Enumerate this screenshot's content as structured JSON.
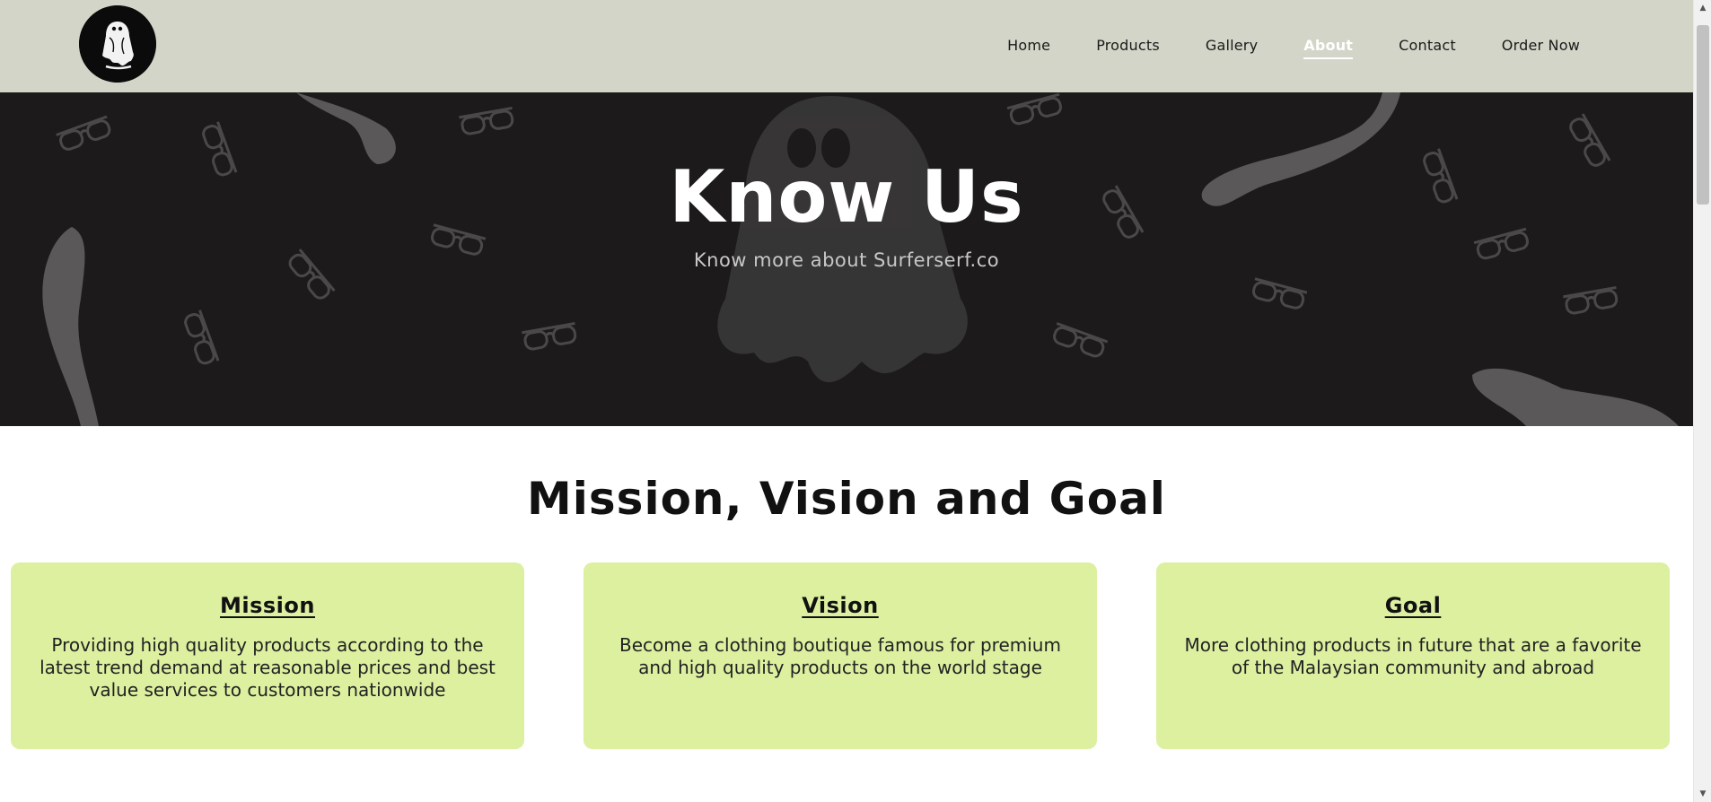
{
  "navbar": {
    "logo_icon": "ghost-logo-icon",
    "links": [
      {
        "label": "Home",
        "active": false
      },
      {
        "label": "Products",
        "active": false
      },
      {
        "label": "Gallery",
        "active": false
      },
      {
        "label": "About",
        "active": true
      },
      {
        "label": "Contact",
        "active": false
      },
      {
        "label": "Order Now",
        "active": false
      }
    ]
  },
  "hero": {
    "title": "Know Us",
    "subtitle": "Know more about Surferserf.co",
    "background_icons": [
      "ghost-icon",
      "glasses-icon",
      "ghost-arm-icon"
    ]
  },
  "section": {
    "title": "Mission, Vision and Goal",
    "cards": [
      {
        "title": "Mission",
        "text": "Providing high quality products according to the latest trend demand at reasonable prices and best value services to customers nationwide"
      },
      {
        "title": "Vision",
        "text": "Become a clothing boutique famous for premium and high quality products on the world stage"
      },
      {
        "title": "Goal",
        "text": "More clothing products in future that are a favorite of the Malaysian community and abroad"
      }
    ]
  },
  "colors": {
    "navbar_bg": "#d3d5c8",
    "hero_bg": "#1c1a1b",
    "card_bg": "#dcf0a0",
    "active_link": "#ffffff"
  }
}
